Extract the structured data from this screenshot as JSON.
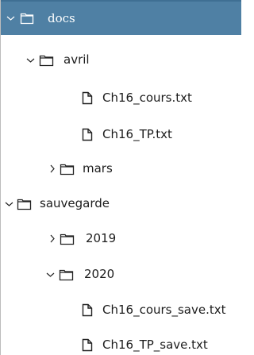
{
  "colors": {
    "selection_background": "#4f80a4",
    "selected_text": "#ffffff",
    "text": "#1c1c1c",
    "icon_stroke": "#222222"
  },
  "tree": {
    "docs": {
      "label": "docs",
      "expanded": true,
      "selected": true,
      "icon": "folder-icon",
      "chevron": "chevron-down-icon"
    },
    "avril": {
      "label": "avril",
      "expanded": true,
      "icon": "folder-icon",
      "chevron": "chevron-down-icon"
    },
    "avril_file_1": {
      "label": "Ch16_cours.txt",
      "icon": "file-icon"
    },
    "avril_file_2": {
      "label": "Ch16_TP.txt",
      "icon": "file-icon"
    },
    "mars": {
      "label": "mars",
      "expanded": false,
      "icon": "folder-icon",
      "chevron": "chevron-right-icon"
    },
    "sauvegarde": {
      "label": "sauvegarde",
      "expanded": true,
      "icon": "folder-icon",
      "chevron": "chevron-down-icon"
    },
    "folder_2019": {
      "label": "2019",
      "expanded": false,
      "icon": "folder-icon",
      "chevron": "chevron-right-icon"
    },
    "folder_2020": {
      "label": "2020",
      "expanded": true,
      "icon": "folder-icon",
      "chevron": "chevron-down-icon"
    },
    "save_file_1": {
      "label": "Ch16_cours_save.txt",
      "icon": "file-icon"
    },
    "save_file_2": {
      "label": "Ch16_TP_save.txt",
      "icon": "file-icon"
    }
  }
}
